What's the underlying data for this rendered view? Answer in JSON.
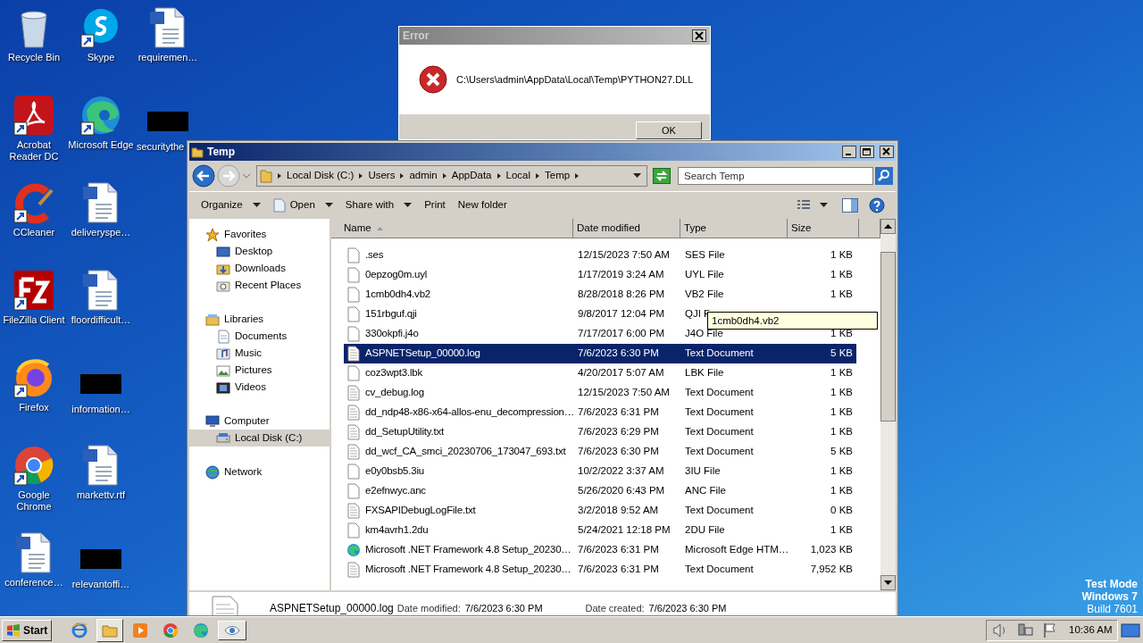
{
  "desktop_icons": [
    {
      "label": "Recycle Bin",
      "kind": "recycle",
      "shortcut": false
    },
    {
      "label": "Skype",
      "kind": "skype",
      "shortcut": true
    },
    {
      "label": "requiremen…",
      "kind": "word",
      "shortcut": false
    },
    {
      "label": "Acrobat Reader DC",
      "kind": "acrobat",
      "shortcut": true
    },
    {
      "label": "Microsoft Edge",
      "kind": "edge",
      "shortcut": true
    },
    {
      "label": "securitythe",
      "kind": "redacted"
    },
    {
      "label": "CCleaner",
      "kind": "ccleaner",
      "shortcut": true
    },
    {
      "label": "deliveryspe…",
      "kind": "word",
      "shortcut": false
    },
    {
      "label": "FileZilla Client",
      "kind": "filezilla",
      "shortcut": true
    },
    {
      "label": "floordifficult…",
      "kind": "word",
      "shortcut": false
    },
    {
      "label": "Firefox",
      "kind": "firefox",
      "shortcut": true
    },
    {
      "label": "information…",
      "kind": "redacted"
    },
    {
      "label": "Google Chrome",
      "kind": "chrome",
      "shortcut": true
    },
    {
      "label": "markettv.rtf",
      "kind": "word",
      "shortcut": false
    },
    {
      "label": "conference…",
      "kind": "word",
      "shortcut": false
    },
    {
      "label": "relevantoffi…",
      "kind": "redacted"
    }
  ],
  "error_dialog": {
    "title": "Error",
    "message": "C:\\Users\\admin\\AppData\\Local\\Temp\\PYTHON27.DLL",
    "button": "OK"
  },
  "explorer": {
    "title": "Temp",
    "breadcrumb": [
      "Local Disk (C:)",
      "Users",
      "admin",
      "AppData",
      "Local",
      "Temp"
    ],
    "search": {
      "placeholder": "Search Temp"
    },
    "toolbar": [
      {
        "label": "Organize",
        "kind": "plain",
        "dropdown": true
      },
      {
        "label": "Open",
        "kind": "open",
        "dropdown": true
      },
      {
        "label": "Share with",
        "kind": "plain",
        "dropdown": true
      },
      {
        "label": "Print",
        "kind": "plain",
        "dropdown": false
      },
      {
        "label": "New folder",
        "kind": "plain",
        "dropdown": false
      }
    ],
    "nav": [
      {
        "label": "Favorites",
        "kind": "star",
        "selected": false,
        "children": [
          {
            "label": "Desktop",
            "kind": "desktop",
            "selected": false
          },
          {
            "label": "Downloads",
            "kind": "downloads",
            "selected": false
          },
          {
            "label": "Recent Places",
            "kind": "recent",
            "selected": false
          }
        ]
      },
      {
        "label": "Libraries",
        "kind": "libraries",
        "selected": false,
        "children": [
          {
            "label": "Documents",
            "kind": "documents",
            "selected": false
          },
          {
            "label": "Music",
            "kind": "music",
            "selected": false
          },
          {
            "label": "Pictures",
            "kind": "pictures",
            "selected": false
          },
          {
            "label": "Videos",
            "kind": "videos",
            "selected": false
          }
        ]
      },
      {
        "label": "Computer",
        "kind": "computer",
        "selected": false,
        "children": [
          {
            "label": "Local Disk (C:)",
            "kind": "disk",
            "selected": true
          }
        ]
      },
      {
        "label": "Network",
        "kind": "network",
        "selected": false
      }
    ],
    "columns": [
      {
        "label": "Name",
        "sorted": true
      },
      {
        "label": "Date modified",
        "sorted": false
      },
      {
        "label": "Type",
        "sorted": false
      },
      {
        "label": "Size",
        "sorted": false
      }
    ],
    "rows": [
      {
        "name": ".ses",
        "date": "12/15/2023 7:50 AM",
        "type": "SES File",
        "size": "1 KB",
        "kind": "plain",
        "selected": false
      },
      {
        "name": "0epzog0m.uyl",
        "date": "1/17/2019 3:24 AM",
        "type": "UYL File",
        "size": "1 KB",
        "kind": "plain",
        "selected": false
      },
      {
        "name": "1cmb0dh4.vb2",
        "date": "8/28/2018 8:26 PM",
        "type": "VB2 File",
        "size": "1 KB",
        "kind": "plain",
        "selected": false
      },
      {
        "name": "151rbguf.qji",
        "date": "9/8/2017 12:04 PM",
        "type": "QJI F",
        "kind": "plain",
        "selected": false
      },
      {
        "name": "330okpfi.j4o",
        "date": "7/17/2017 6:00 PM",
        "type": "J4O File",
        "size": "1 KB",
        "kind": "plain",
        "selected": false
      },
      {
        "name": "ASPNETSetup_00000.log",
        "date": "7/6/2023 6:30 PM",
        "type": "Text Document",
        "size": "5 KB",
        "kind": "text",
        "selected": true
      },
      {
        "name": "coz3wpt3.lbk",
        "date": "4/20/2017 5:07 AM",
        "type": "LBK File",
        "size": "1 KB",
        "kind": "plain",
        "selected": false
      },
      {
        "name": "cv_debug.log",
        "date": "12/15/2023 7:50 AM",
        "type": "Text Document",
        "size": "1 KB",
        "kind": "text",
        "selected": false
      },
      {
        "name": "dd_ndp48-x86-x64-allos-enu_decompression…",
        "date": "7/6/2023 6:31 PM",
        "type": "Text Document",
        "size": "1 KB",
        "kind": "text",
        "selected": false
      },
      {
        "name": "dd_SetupUtility.txt",
        "date": "7/6/2023 6:29 PM",
        "type": "Text Document",
        "size": "1 KB",
        "kind": "text",
        "selected": false
      },
      {
        "name": "dd_wcf_CA_smci_20230706_173047_693.txt",
        "date": "7/6/2023 6:30 PM",
        "type": "Text Document",
        "size": "5 KB",
        "kind": "text",
        "selected": false
      },
      {
        "name": "e0y0bsb5.3iu",
        "date": "10/2/2022 3:37 AM",
        "type": "3IU File",
        "size": "1 KB",
        "kind": "plain",
        "selected": false
      },
      {
        "name": "e2efnwyc.anc",
        "date": "5/26/2020 6:43 PM",
        "type": "ANC File",
        "size": "1 KB",
        "kind": "plain",
        "selected": false
      },
      {
        "name": "FXSAPIDebugLogFile.txt",
        "date": "3/2/2018 9:52 AM",
        "type": "Text Document",
        "size": "0 KB",
        "kind": "text",
        "selected": false
      },
      {
        "name": "km4avrh1.2du",
        "date": "5/24/2021 12:18 PM",
        "type": "2DU File",
        "size": "1 KB",
        "kind": "plain",
        "selected": false
      },
      {
        "name": "Microsoft .NET Framework 4.8 Setup_20230…",
        "date": "7/6/2023 6:31 PM",
        "type": "Microsoft Edge HTM…",
        "size": "1,023 KB",
        "kind": "edge",
        "selected": false
      },
      {
        "name": "Microsoft .NET Framework 4.8 Setup_20230…",
        "date": "7/6/2023 6:31 PM",
        "type": "Text Document",
        "size": "7,952 KB",
        "kind": "text",
        "selected": false
      }
    ],
    "tooltip": "1cmb0dh4.vb2",
    "details": {
      "name": "ASPNETSetup_00000.log",
      "fields": [
        {
          "label": "Date modified:",
          "value": "7/6/2023 6:30 PM"
        },
        {
          "label": "Date created:",
          "value": "7/6/2023 6:30 PM"
        }
      ]
    }
  },
  "edition_text": [
    "Test Mode",
    "Windows 7",
    "Build 7601"
  ],
  "taskbar": {
    "start": "Start",
    "pinned": [
      {
        "kind": "ie",
        "active": false
      },
      {
        "kind": "folder",
        "active": true
      },
      {
        "kind": "media",
        "active": false
      },
      {
        "kind": "chrome",
        "active": false
      },
      {
        "kind": "edge",
        "active": false
      }
    ],
    "tasks": [
      {
        "kind": "eye",
        "active": true
      }
    ],
    "tray": [
      {
        "kind": "speaker"
      },
      {
        "kind": "network"
      },
      {
        "kind": "flag"
      }
    ],
    "clock": "10:36 AM"
  }
}
